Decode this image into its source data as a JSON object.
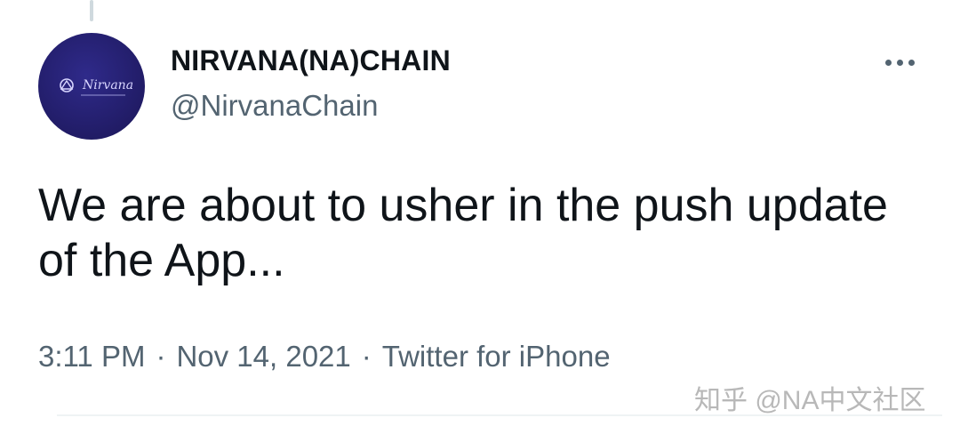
{
  "author": {
    "display_name": "NIRVANA(NA)CHAIN",
    "handle": "@NirvanaChain",
    "avatar_text": "Nirvana"
  },
  "tweet": {
    "text": "We are about to usher in the push update of the App..."
  },
  "meta": {
    "time": "3:11 PM",
    "date": "Nov 14, 2021",
    "source": "Twitter for iPhone",
    "separator": "·"
  },
  "watermark": "知乎 @NA中文社区",
  "icons": {
    "more": "more-horizontal-icon"
  },
  "colors": {
    "text": "#0f1419",
    "secondary": "#536471",
    "avatar_bg": "#241f6e"
  }
}
